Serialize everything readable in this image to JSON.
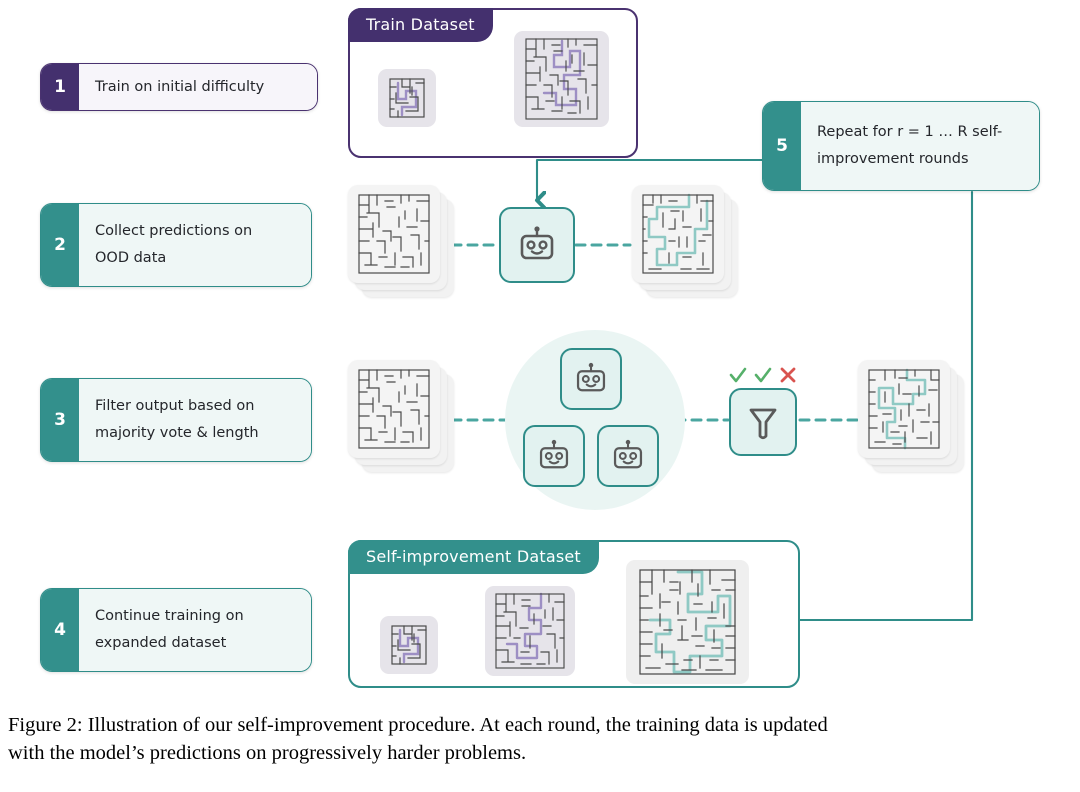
{
  "figure": {
    "caption_line1": "Figure 2: Illustration of our self-improvement procedure. At each round, the training data is updated",
    "caption_line2": "with the model’s predictions on progressively harder problems."
  },
  "colors": {
    "purple": "#44306e",
    "purple_border": "#4a3270",
    "teal": "#33908c",
    "teal_border": "#2f8d89",
    "teal_light": "#e2f2f0",
    "circle_bg": "#eaf5f3",
    "check_green": "#56b06a",
    "cross_red": "#d9534f",
    "maze_wall": "#4a4a4a",
    "maze_path_purple": "#9d8fc4",
    "maze_path_teal": "#8fc9c4",
    "tile_purple_bg": "#e6e4ea",
    "tile_gray_bg": "#efefef",
    "card_bg": "#f2f2f2"
  },
  "steps": [
    {
      "number": "1",
      "lines": [
        "Train on initial difficulty"
      ],
      "accent": "purple"
    },
    {
      "number": "2",
      "lines": [
        "Collect predictions on",
        "OOD data"
      ],
      "accent": "teal"
    },
    {
      "number": "3",
      "lines": [
        "Filter output based on",
        "majority vote & length"
      ],
      "accent": "teal"
    },
    {
      "number": "4",
      "lines": [
        "Continue training on",
        "expanded dataset"
      ],
      "accent": "teal"
    },
    {
      "number": "5",
      "lines": [
        "Repeat for r = 1 … R self-",
        "improvement rounds"
      ],
      "accent": "teal"
    }
  ],
  "panels": {
    "train": {
      "title": "Train Dataset",
      "accent": "purple"
    },
    "self_improvement": {
      "title": "Self-improvement  Dataset",
      "accent": "teal"
    }
  },
  "icons": {
    "robot": "robot-icon",
    "filter": "funnel-icon",
    "check": "✓",
    "cross": "✕"
  },
  "marks": {
    "row3": [
      "check",
      "check",
      "cross"
    ]
  },
  "mazes": {
    "train_small": {
      "size": "small",
      "solved": true,
      "path_color": "purple"
    },
    "train_large": {
      "size": "large",
      "solved": true,
      "path_color": "purple"
    },
    "row2_input": {
      "size": "medium",
      "solved": false,
      "stacked": true
    },
    "row2_output": {
      "size": "medium",
      "solved": true,
      "path_color": "teal",
      "stacked": true
    },
    "row3_input": {
      "size": "medium",
      "solved": false,
      "stacked": true
    },
    "row3_output": {
      "size": "medium",
      "solved": true,
      "path_color": "teal",
      "stacked": true
    },
    "si_small": {
      "size": "small",
      "solved": true,
      "path_color": "purple"
    },
    "si_medium": {
      "size": "medium",
      "solved": true,
      "path_color": "purple"
    },
    "si_large": {
      "size": "large",
      "solved": true,
      "path_color": "teal"
    }
  }
}
